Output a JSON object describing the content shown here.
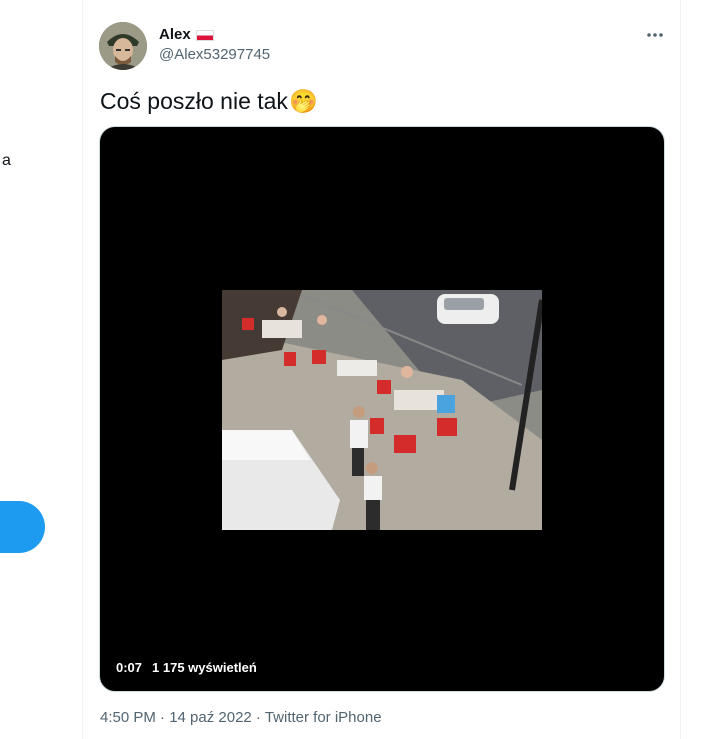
{
  "sidebar": {
    "truncated_letter": "a"
  },
  "tweet": {
    "author_name": "Alex",
    "author_handle": "@Alex53297745",
    "text": "Coś poszło nie tak",
    "emoji": "🤭",
    "video": {
      "duration": "0:07",
      "views": "1 175 wyświetleń"
    },
    "timestamp": "4:50 PM · 14 paź 2022 · Twitter for iPhone"
  },
  "icons": {
    "more": "more-horizontal-icon",
    "flag": "poland-flag-icon"
  },
  "colors": {
    "accent": "#1d9bf0",
    "text": "#0f1419",
    "muted": "#536471",
    "media_bg": "#000000"
  }
}
